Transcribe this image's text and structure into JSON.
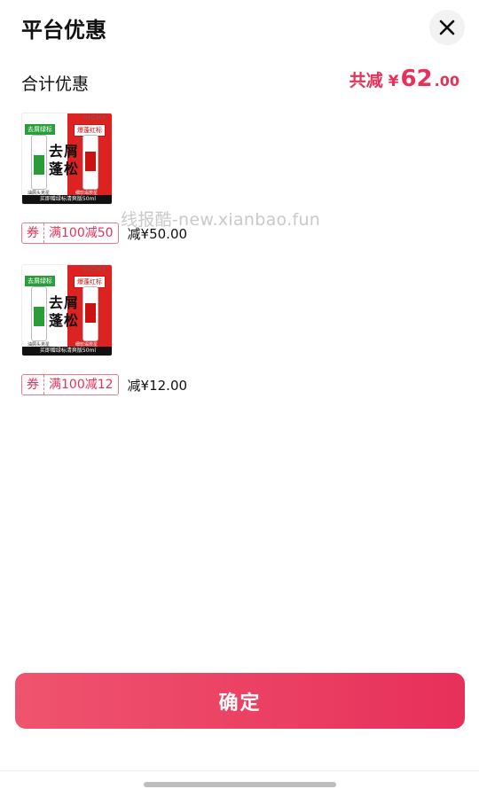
{
  "header": {
    "title": "平台优惠",
    "close_icon": "close-icon"
  },
  "summary": {
    "label": "合计优惠",
    "total_prefix": "共减",
    "currency": "¥",
    "total_integer": "62",
    "total_decimal": ".00",
    "accent_color": "#e8315a"
  },
  "items": [
    {
      "thumb": {
        "brand": "VICHY",
        "tag_left": "去屑绿标",
        "tag_right": "爆蓬红标",
        "headline_top": "去屑",
        "headline_bottom": "蓬松",
        "caption_left": "油屑头克星",
        "caption_right": "细软塌救星",
        "footer": "买即赠绿标清爽版50ml"
      },
      "coupon_tag": "券",
      "coupon_rule": "满100减50",
      "discount": "减¥50.00"
    },
    {
      "thumb": {
        "brand": "VICHY",
        "tag_left": "去屑绿标",
        "tag_right": "爆蓬红标",
        "headline_top": "去屑",
        "headline_bottom": "蓬松",
        "caption_left": "油屑头克星",
        "caption_right": "细软塌救星",
        "footer": "买即赠绿标清爽版50ml"
      },
      "coupon_tag": "券",
      "coupon_rule": "满100减12",
      "discount": "减¥12.00"
    }
  ],
  "watermark": "线报酷-new.xianbao.fun",
  "confirm_label": "确定"
}
